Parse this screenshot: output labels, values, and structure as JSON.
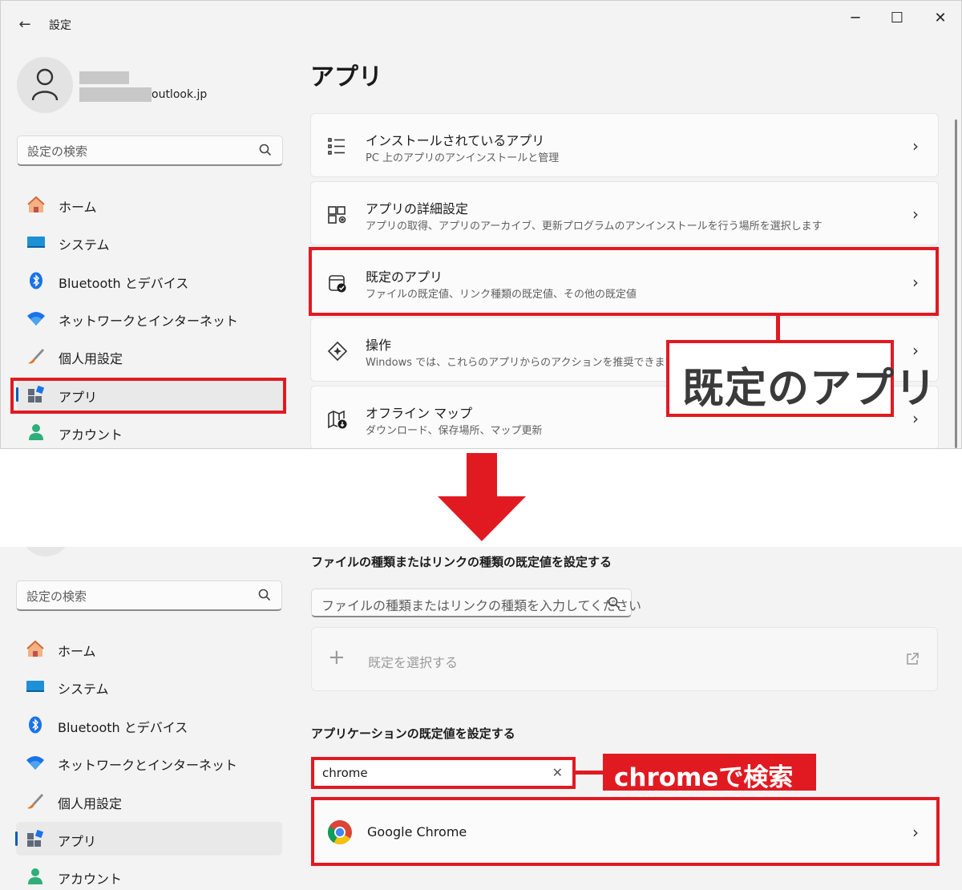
{
  "window": {
    "back_icon": "←",
    "title": "設定",
    "minimize": "─",
    "maximize": "☐",
    "close": "✕"
  },
  "profile": {
    "email_suffix": "outlook.jp"
  },
  "search": {
    "placeholder": "設定の検索"
  },
  "sidebar": {
    "items": [
      {
        "label": "ホーム",
        "icon": "home-icon"
      },
      {
        "label": "システム",
        "icon": "system-icon"
      },
      {
        "label": "Bluetooth とデバイス",
        "icon": "bluetooth-icon"
      },
      {
        "label": "ネットワークとインターネット",
        "icon": "wifi-icon"
      },
      {
        "label": "個人用設定",
        "icon": "brush-icon"
      },
      {
        "label": "アプリ",
        "icon": "apps-icon",
        "selected": true
      },
      {
        "label": "アカウント",
        "icon": "account-icon"
      }
    ]
  },
  "main": {
    "title": "アプリ",
    "cards": [
      {
        "title": "インストールされているアプリ",
        "subtitle": "PC 上のアプリのアンインストールと管理"
      },
      {
        "title": "アプリの詳細設定",
        "subtitle": "アプリの取得、アプリのアーカイブ、更新プログラムのアンインストールを行う場所を選択します"
      },
      {
        "title": "既定のアプリ",
        "subtitle": "ファイルの既定値、リンク種類の既定値、その他の既定値"
      },
      {
        "title": "操作",
        "subtitle": "Windows では、これらのアプリからのアクションを推奨できます。"
      },
      {
        "title": "オフライン マップ",
        "subtitle": "ダウンロード、保存場所、マップ更新"
      }
    ],
    "chevron": "›"
  },
  "annotations": {
    "callout_default_apps": "既定のアプリ",
    "callout_search": "chromeで検索",
    "accent_color": "#e11a22"
  },
  "default_apps": {
    "file_type_section": "ファイルの種類またはリンクの種類の既定値を設定する",
    "file_type_placeholder": "ファイルの種類またはリンクの種類を入力してください",
    "choose_default_plus": "+",
    "choose_default_label": "既定を選択する",
    "app_section": "アプリケーションの既定値を設定する",
    "app_search_value": "chrome",
    "app_search_clear": "✕",
    "results": [
      {
        "name": "Google Chrome",
        "icon": "chrome-icon"
      }
    ]
  }
}
